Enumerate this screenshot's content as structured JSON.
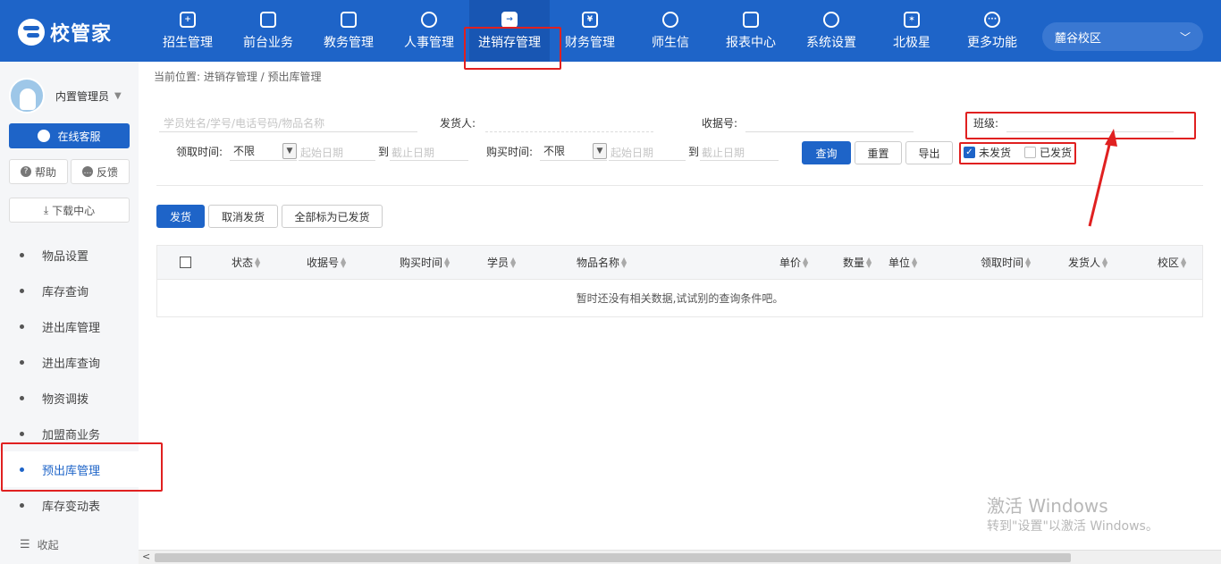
{
  "app": {
    "logo_text": "校管家"
  },
  "nav": [
    {
      "label": "招生管理",
      "icon": "user-plus-icon",
      "glyph": "+"
    },
    {
      "label": "前台业务",
      "icon": "monitor-icon",
      "glyph": ""
    },
    {
      "label": "教务管理",
      "icon": "book-icon",
      "glyph": ""
    },
    {
      "label": "人事管理",
      "icon": "person-icon",
      "glyph": ""
    },
    {
      "label": "进销存管理",
      "icon": "inventory-icon",
      "glyph": "→",
      "active": true
    },
    {
      "label": "财务管理",
      "icon": "finance-icon",
      "glyph": "¥"
    },
    {
      "label": "师生信",
      "icon": "chat-icon",
      "glyph": ""
    },
    {
      "label": "报表中心",
      "icon": "report-icon",
      "glyph": ""
    },
    {
      "label": "系统设置",
      "icon": "settings-icon",
      "glyph": ""
    },
    {
      "label": "北极星",
      "icon": "star-icon",
      "glyph": "✶"
    },
    {
      "label": "更多功能",
      "icon": "more-icon",
      "glyph": "···"
    }
  ],
  "campus": {
    "label": "麓谷校区"
  },
  "sidebar": {
    "user_name": "内置管理员",
    "online_service": "在线客服",
    "help": "帮助",
    "feedback": "反馈",
    "download_center": "下载中心",
    "menu": [
      {
        "label": "物品设置"
      },
      {
        "label": "库存查询"
      },
      {
        "label": "进出库管理"
      },
      {
        "label": "进出库查询"
      },
      {
        "label": "物资调拨"
      },
      {
        "label": "加盟商业务"
      },
      {
        "label": "预出库管理",
        "active": true
      },
      {
        "label": "库存变动表"
      }
    ],
    "collapse": "收起"
  },
  "breadcrumb": "当前位置: 进销存管理 / 预出库管理",
  "filters": {
    "search_placeholder": "学员姓名/学号/电话号码/物品名称",
    "shipper_label": "发货人:",
    "receipt_label": "收据号:",
    "class_label": "班级:",
    "receive_time_label": "领取时间:",
    "receive_time_value": "不限",
    "receive_start_placeholder": "起始日期",
    "to1": "到",
    "receive_end_placeholder": "截止日期",
    "buy_time_label": "购买时间:",
    "buy_time_value": "不限",
    "buy_start_placeholder": "起始日期",
    "to2": "到",
    "buy_end_placeholder": "截止日期",
    "query": "查询",
    "reset": "重置",
    "export": "导出",
    "unshipped": "未发货",
    "shipped": "已发货"
  },
  "actions": {
    "ship": "发货",
    "cancel_ship": "取消发货",
    "mark_all_shipped": "全部标为已发货"
  },
  "table": {
    "columns": [
      "状态",
      "收据号",
      "购买时间",
      "学员",
      "物品名称",
      "单价",
      "数量",
      "单位",
      "领取时间",
      "发货人",
      "校区"
    ],
    "empty_text": "暂时还没有相关数据,试试别的查询条件吧。"
  },
  "watermark": {
    "line1": "激活 Windows",
    "line2": "转到\"设置\"以激活 Windows。"
  },
  "colors": {
    "brand": "#1e64c8",
    "annotation": "#e02020"
  }
}
